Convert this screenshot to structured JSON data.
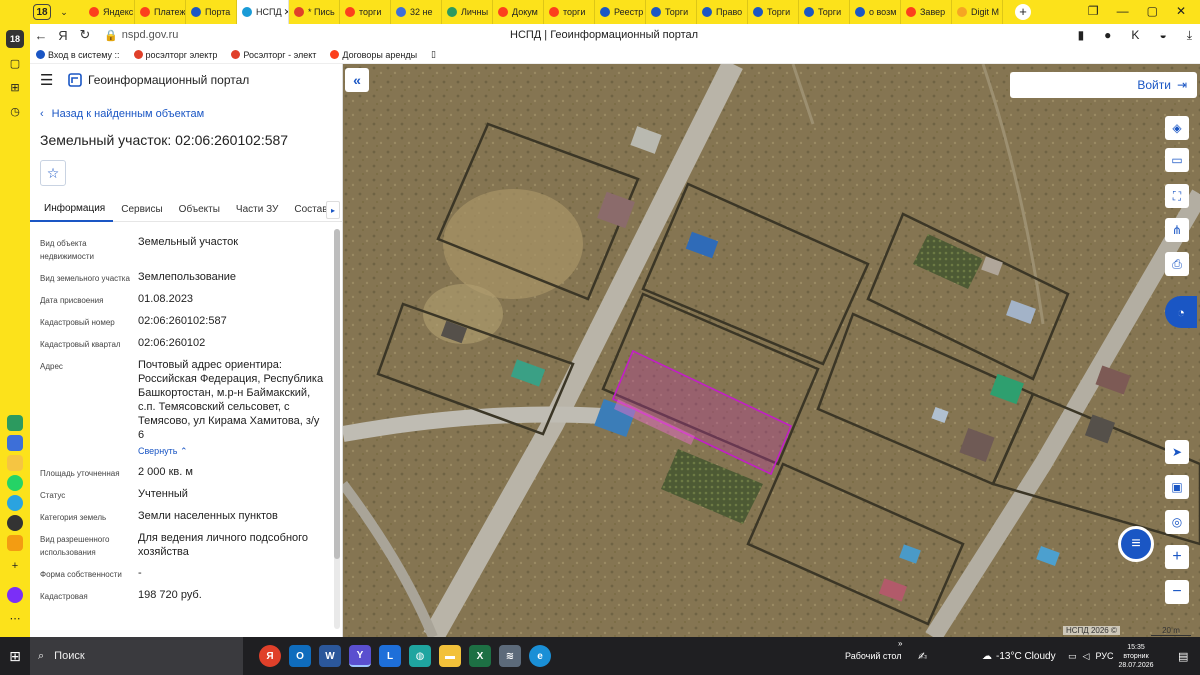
{
  "browser": {
    "tab_count": "18",
    "tabs": [
      {
        "label": "Яндекс",
        "color": "#fc3f1d"
      },
      {
        "label": "Платеж",
        "color": "#fc3f1d"
      },
      {
        "label": "Порта",
        "color": "#1a56c4"
      },
      {
        "label": "НСПД",
        "color": "#1a9bd7",
        "active": true
      },
      {
        "label": "* Пись",
        "color": "#e0402a"
      },
      {
        "label": "торги",
        "color": "#fc3f1d"
      },
      {
        "label": "32 не",
        "color": "#3d6fd8"
      },
      {
        "label": "Личны",
        "color": "#2c9a5f"
      },
      {
        "label": "Докум",
        "color": "#fc3f1d"
      },
      {
        "label": "торги",
        "color": "#fc3f1d"
      },
      {
        "label": "Реестр",
        "color": "#1a56c4"
      },
      {
        "label": "Торги",
        "color": "#1a56c4"
      },
      {
        "label": "Право",
        "color": "#1a56c4"
      },
      {
        "label": "Торги",
        "color": "#1a56c4"
      },
      {
        "label": "Торги",
        "color": "#1a56c4"
      },
      {
        "label": "о возм",
        "color": "#1a56c4"
      },
      {
        "label": "Завер",
        "color": "#fc3f1d"
      },
      {
        "label": "Digit M",
        "color": "#f5a623"
      }
    ],
    "url": "nspd.gov.ru",
    "page_title": "НСПД | Геоинформационный портал",
    "bookmarks": [
      {
        "label": "Вход в систему ::",
        "color": "#1a56c4"
      },
      {
        "label": "росэлторг электр",
        "color": "#e0402a"
      },
      {
        "label": "Росэлторг - элект",
        "color": "#e0402a"
      },
      {
        "label": "Договоры аренды",
        "color": "#fc3f1d"
      }
    ]
  },
  "panel": {
    "portal_title": "Геоинформационный портал",
    "back_link": "Назад к найденным объектам",
    "parcel_title": "Земельный участок: 02:06:260102:587",
    "tabs": [
      "Информация",
      "Сервисы",
      "Объекты",
      "Части ЗУ",
      "Состав"
    ],
    "properties": [
      {
        "label": "Вид объекта недвижимости",
        "value": "Земельный участок"
      },
      {
        "label": "Вид земельного участка",
        "value": "Землепользование"
      },
      {
        "label": "Дата присвоения",
        "value": "01.08.2023"
      },
      {
        "label": "Кадастровый номер",
        "value": "02:06:260102:587"
      },
      {
        "label": "Кадастровый квартал",
        "value": "02:06:260102"
      },
      {
        "label": "Адрес",
        "value": "Почтовый адрес ориентира: Российская Федерация, Республика Башкортостан, м.р-н Баймакский, с.п. Темясовский сельсовет, с Темясово, ул Кирама Хамитова, з/у 6"
      },
      {
        "label": "Площадь уточненная",
        "value": "2 000 кв. м"
      },
      {
        "label": "Статус",
        "value": "Учтенный"
      },
      {
        "label": "Категория земель",
        "value": "Земли населенных пунктов"
      },
      {
        "label": "Вид разрешенного использования",
        "value": "Для ведения личного подсобного хозяйства"
      },
      {
        "label": "Форма собственности",
        "value": "-"
      },
      {
        "label": "Кадастровая",
        "value": "198 720 руб."
      }
    ],
    "collapse_label": "Свернуть"
  },
  "map": {
    "login_label": "Войти",
    "credit": "НСПД 2026 ©",
    "scale": "20 m"
  },
  "taskbar": {
    "search_label": "Поиск",
    "desktop_label": "Рабочий стол",
    "weather": "-13°C  Cloudy",
    "lang": "РУС",
    "time": "15:35",
    "weekday": "вторник",
    "date": "28.07.2026"
  }
}
